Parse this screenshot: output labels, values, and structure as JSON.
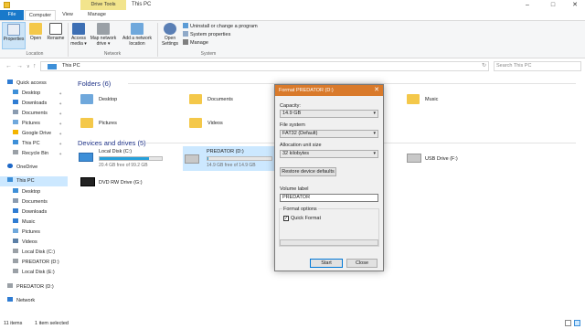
{
  "titlebar": {
    "context_tab": "Drive Tools",
    "title": "This PC",
    "minimize": "–",
    "maximize": "□",
    "close": "✕"
  },
  "tabs": {
    "file": "File",
    "computer": "Computer",
    "view": "View",
    "manage": "Manage"
  },
  "ribbon": {
    "properties": "Properties",
    "open": "Open",
    "rename": "Rename",
    "access_media": "Access media ▾",
    "map_network_drive": "Map network drive ▾",
    "add_network_location": "Add a network location",
    "open_settings": "Open Settings",
    "uninstall": "Uninstall or change a program",
    "system_properties": "System properties",
    "manage": "Manage",
    "group_location": "Location",
    "group_network": "Network",
    "group_system": "System"
  },
  "address": {
    "back": "←",
    "forward": "→",
    "down": "∨",
    "up": "↑",
    "path": "This PC",
    "search_placeholder": "Search This PC",
    "refresh": "↻"
  },
  "nav": {
    "quick_access": "Quick access",
    "desktop": "Desktop",
    "downloads": "Downloads",
    "documents": "Documents",
    "pictures": "Pictures",
    "google_drive": "Google Drive",
    "this_pc_q": "This PC",
    "recycle_bin": "Recycle Bin",
    "onedrive": "OneDrive",
    "this_pc": "This PC",
    "desktop2": "Desktop",
    "documents2": "Documents",
    "downloads2": "Downloads",
    "music": "Music",
    "pictures2": "Pictures",
    "videos": "Videos",
    "local_disk": "Local Disk (C:)",
    "predator": "PREDATOR (D:)",
    "local_disk_e": "Local Disk (E:)",
    "predator2": "PREDATOR (D:)",
    "network": "Network"
  },
  "folders": {
    "header": "Folders (6)",
    "items": [
      "Desktop",
      "Documents",
      "Music",
      "Pictures",
      "Videos"
    ]
  },
  "drives": {
    "header": "Devices and drives (5)",
    "local_c": {
      "name": "Local Disk (C:)",
      "free": "20.4 GB free of 99.2 GB",
      "fill": 0.79
    },
    "predator": {
      "name": "PREDATOR (D:)",
      "free": "14.9 GB free of 14.9 GB",
      "fill": 0.02
    },
    "usb": {
      "name": "USB Drive (F:)"
    },
    "dvd": {
      "name": "DVD RW Drive (G:)"
    }
  },
  "status": {
    "count": "11 items",
    "selected": "1 item selected"
  },
  "dialog": {
    "title": "Format PREDATOR (D:)",
    "close": "✕",
    "capacity_label": "Capacity:",
    "capacity": "14.9 GB",
    "fs_label": "File system",
    "fs": "FAT32 (Default)",
    "alloc_label": "Allocation unit size",
    "alloc": "32 kilobytes",
    "restore_btn": "Restore device defaults",
    "volume_label": "Volume label",
    "volume": "PREDATOR",
    "options_label": "Format options",
    "quick_format": "Quick Format",
    "check": "✓",
    "start": "Start",
    "close_btn": "Close"
  }
}
